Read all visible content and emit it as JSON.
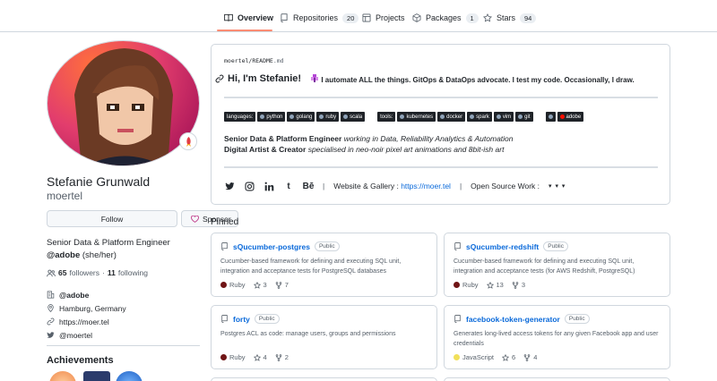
{
  "tabs": [
    {
      "label": "Overview",
      "count": ""
    },
    {
      "label": "Repositories",
      "count": "20"
    },
    {
      "label": "Projects",
      "count": ""
    },
    {
      "label": "Packages",
      "count": "1"
    },
    {
      "label": "Stars",
      "count": "94"
    }
  ],
  "profile": {
    "name": "Stefanie Grunwald",
    "login": "moertel",
    "follow_label": "Follow",
    "sponsor_label": "Sponsor",
    "bio_line1": "Senior Data & Platform Engineer",
    "bio_org": "@adobe",
    "bio_pronouns": "(she/her)",
    "followers_count": "65",
    "followers_label": "followers",
    "following_count": "11",
    "following_label": "following",
    "dot_sep": "·",
    "company": "@adobe",
    "location": "Hamburg, Germany",
    "website": "https://moer.tel",
    "twitter": "@moertel",
    "achievements_title": "Achievements"
  },
  "readme": {
    "path_user": "moertel",
    "path_sep": "/",
    "path_file": "README",
    "path_ext": ".md",
    "greeting": "Hi, I'm Stefanie!",
    "tagline": "I automate ALL the things. GitOps & DataOps advocate. I test my code. Occasionally, I draw.",
    "languages_label": "languages:",
    "languages": [
      "python",
      "golang",
      "ruby",
      "scala"
    ],
    "tools_label": "tools:",
    "tools": [
      "kubernetes",
      "docker",
      "spark",
      "vim",
      "git"
    ],
    "extra_badge": "adobe",
    "role1_title": "Senior Data & Platform Engineer",
    "role1_desc": "working in Data, Reliability Analytics & Automation",
    "role2_title": "Digital Artist & Creator",
    "role2_desc": "specialised in neo-noir pixel art animations and 8bit-ish art",
    "social_icons": [
      "twitter-icon",
      "instagram-icon",
      "linkedin-icon",
      "tumblr-icon",
      "behance-icon"
    ],
    "behance_text": "Bē",
    "tumblr_text": "t",
    "website_label": "Website & Gallery :",
    "website_link": "https://moer.tel",
    "opensource_label": "Open Source Work :",
    "opensource_icons": "▾ ▾ ▾",
    "bar": "|"
  },
  "pinned": {
    "title": "Pinned",
    "repos": [
      {
        "name": "sQucumber-postgres",
        "visibility": "Public",
        "description": "Cucumber-based framework for defining and executing SQL unit, integration and acceptance tests for PostgreSQL databases",
        "language": "Ruby",
        "lang_color": "#701516",
        "stars": "3",
        "forks": "7"
      },
      {
        "name": "sQucumber-redshift",
        "visibility": "Public",
        "description": "Cucumber-based framework for defining and executing SQL unit, integration and acceptance tests (for AWS Redshift, PostgreSQL)",
        "language": "Ruby",
        "lang_color": "#701516",
        "stars": "13",
        "forks": "3"
      },
      {
        "name": "forty",
        "visibility": "Public",
        "description": "Postgres ACL as code: manage users, groups and permissions",
        "language": "Ruby",
        "lang_color": "#701516",
        "stars": "4",
        "forks": "2"
      },
      {
        "name": "facebook-token-generator",
        "visibility": "Public",
        "description": "Generates long-lived access tokens for any given Facebook app and user credentials",
        "language": "JavaScript",
        "lang_color": "#f1e05a",
        "stars": "6",
        "forks": "4"
      }
    ]
  },
  "colors": {
    "accent": "#fd8c73",
    "link": "#0969da",
    "border": "#d0d7de"
  }
}
